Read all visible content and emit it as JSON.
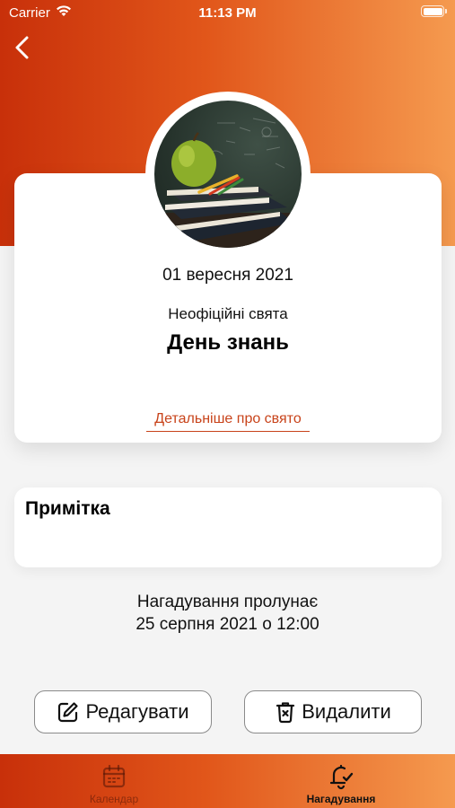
{
  "status_bar": {
    "carrier": "Carrier",
    "time": "11:13 PM"
  },
  "event": {
    "date": "01 вересня 2021",
    "category": "Неофіційні свята",
    "title": "День знань",
    "details_link": "Детальніше про свято"
  },
  "note": {
    "title": "Примітка"
  },
  "reminder": {
    "line1": "Нагадування пролунає",
    "line2": "25 серпня 2021 о 12:00"
  },
  "actions": {
    "edit_label": "Редагувати",
    "delete_label": "Видалити"
  },
  "tab_bar": {
    "items": [
      {
        "label": "Календар",
        "icon": "calendar-icon",
        "active": false
      },
      {
        "label": "Нагадування",
        "icon": "bell-check-icon",
        "active": true
      }
    ]
  },
  "colors": {
    "accent": "#c8431a",
    "gradient_start": "#c8300a",
    "gradient_end": "#f59a4f"
  }
}
